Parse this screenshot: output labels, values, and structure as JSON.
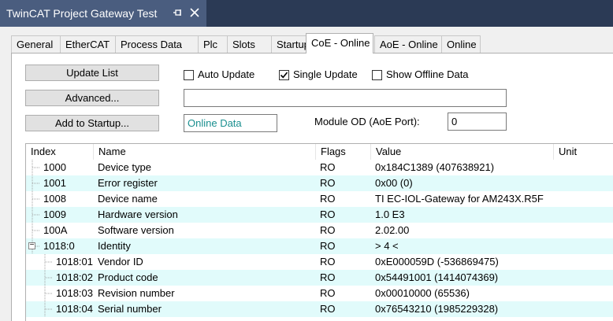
{
  "window": {
    "title": "TwinCAT Project Gateway Test",
    "pin_icon": "pin-icon",
    "close_icon": "close-icon"
  },
  "tabs": [
    {
      "label": "General"
    },
    {
      "label": "EtherCAT"
    },
    {
      "label": "Process Data"
    },
    {
      "label": "Plc"
    },
    {
      "label": "Slots"
    },
    {
      "label": "Startup"
    },
    {
      "label": "CoE - Online",
      "active": true
    },
    {
      "label": "AoE - Online"
    },
    {
      "label": "Online"
    }
  ],
  "buttons": {
    "update_list": "Update List",
    "advanced": "Advanced...",
    "add_to_startup": "Add to Startup..."
  },
  "checks": {
    "auto_update": {
      "label": "Auto Update",
      "checked": false
    },
    "single_update": {
      "label": "Single Update",
      "checked": true
    },
    "show_offline": {
      "label": "Show Offline Data",
      "checked": false
    }
  },
  "info_field": "",
  "online_data": "Online Data",
  "online_data_color": "#1a8f8f",
  "module_od_label": "Module OD (AoE Port):",
  "module_od_value": "0",
  "list": {
    "columns": {
      "index": "Index",
      "name": "Name",
      "flags": "Flags",
      "value": "Value",
      "unit": "Unit"
    },
    "alt_row_color": "#e1fbfb",
    "rows": [
      {
        "index": "1000",
        "name": "Device type",
        "flags": "RO",
        "value": "0x184C1389 (407638921)",
        "level": 0,
        "expander": ""
      },
      {
        "index": "1001",
        "name": "Error register",
        "flags": "RO",
        "value": "0x00 (0)",
        "level": 0,
        "expander": ""
      },
      {
        "index": "1008",
        "name": "Device name",
        "flags": "RO",
        "value": "TI EC-IOL-Gateway for AM243X.R5F",
        "level": 0,
        "expander": ""
      },
      {
        "index": "1009",
        "name": "Hardware version",
        "flags": "RO",
        "value": "1.0 E3",
        "level": 0,
        "expander": ""
      },
      {
        "index": "100A",
        "name": "Software version",
        "flags": "RO",
        "value": "2.02.00",
        "level": 0,
        "expander": ""
      },
      {
        "index": "1018:0",
        "name": "Identity",
        "flags": "RO",
        "value": "> 4 <",
        "level": 0,
        "expander": "−"
      },
      {
        "index": "1018:01",
        "name": "Vendor ID",
        "flags": "RO",
        "value": "0xE000059D (-536869475)",
        "level": 1,
        "expander": ""
      },
      {
        "index": "1018:02",
        "name": "Product code",
        "flags": "RO",
        "value": "0x54491001 (1414074369)",
        "level": 1,
        "expander": ""
      },
      {
        "index": "1018:03",
        "name": "Revision number",
        "flags": "RO",
        "value": "0x00010000 (65536)",
        "level": 1,
        "expander": ""
      },
      {
        "index": "1018:04",
        "name": "Serial number",
        "flags": "RO",
        "value": "0x76543210 (1985229328)",
        "level": 1,
        "expander": ""
      }
    ]
  }
}
